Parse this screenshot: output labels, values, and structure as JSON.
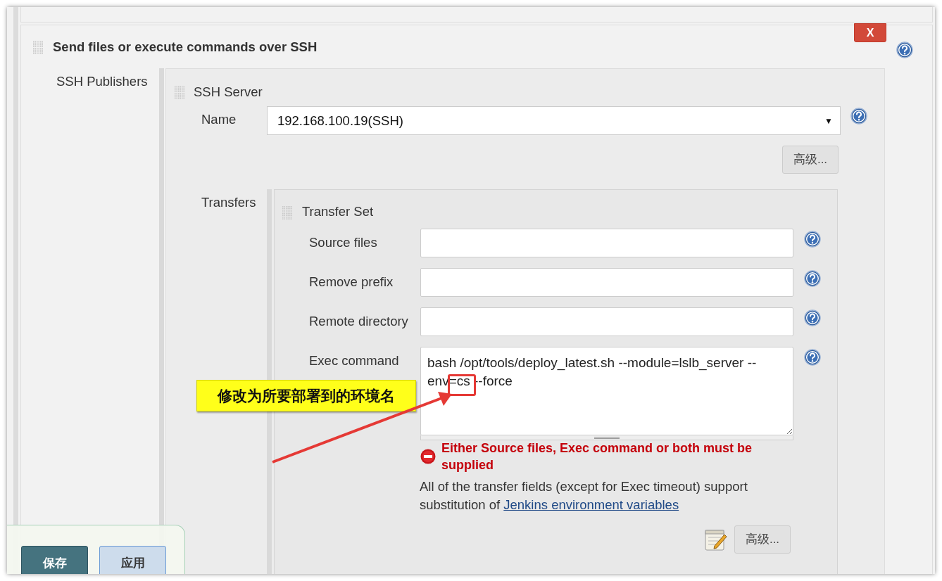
{
  "section": {
    "title": "Send files or execute commands over SSH",
    "delete_button": "X"
  },
  "publishers_label": "SSH Publishers",
  "server": {
    "title": "SSH Server",
    "name_label": "Name",
    "name_value": "192.168.100.19(SSH)",
    "dropdown_caret": "▼",
    "advanced_button": "高级..."
  },
  "transfers_label": "Transfers",
  "transfer_set": {
    "title": "Transfer Set",
    "fields": [
      {
        "label": "Source files",
        "kind": "input"
      },
      {
        "label": "Remove prefix",
        "kind": "input"
      },
      {
        "label": "Remote directory",
        "kind": "input"
      },
      {
        "label": "Exec command",
        "kind": "textarea",
        "value": "bash /opt/tools/deploy_latest.sh --module=lslb_server --env=cs --force"
      }
    ],
    "error": "Either Source files, Exec command or both must be supplied",
    "info": "All of the transfer fields (except for Exec timeout) support substitution of ",
    "info_link": "Jenkins environment variables",
    "advanced_button": "高级..."
  },
  "annotation": {
    "text": "修改为所要部署到的环境名"
  },
  "bottom_bar": {
    "buttons": [
      {
        "label": "保存",
        "kind": "primary"
      },
      {
        "label": "应用",
        "kind": "secondary"
      }
    ]
  }
}
